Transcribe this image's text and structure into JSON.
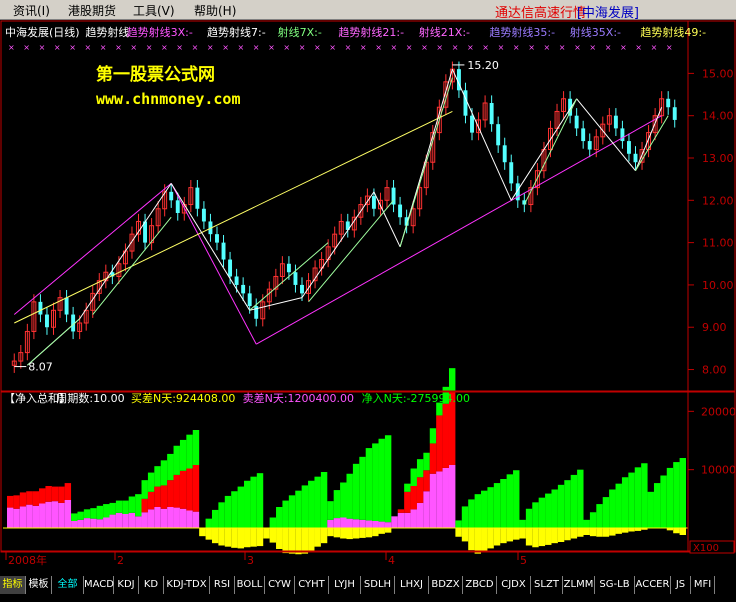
{
  "menu": [
    "资讯(I)",
    "港股期货",
    "工具(V)",
    "帮助(H)"
  ],
  "window": {
    "title": "通达信高速行情",
    "security": "[中海发展]"
  },
  "upper_header": [
    {
      "text": "中海发展(日线)",
      "color": "#ffffff"
    },
    {
      "text": "趋势射线",
      "color": "#ffffff"
    },
    {
      "text": "趋势射线3X:-",
      "color": "#ff55ff"
    },
    {
      "text": "趋势射线7:-",
      "color": "#ffffff"
    },
    {
      "text": "射线7X:-",
      "color": "#80ff80"
    },
    {
      "text": "趋势射线21:-",
      "color": "#ff66ff"
    },
    {
      "text": "射线21X:-",
      "color": "#ff66ff"
    },
    {
      "text": "趋势射线35:-",
      "color": "#9b7bff"
    },
    {
      "text": "射线35X:-",
      "color": "#9b7bff"
    },
    {
      "text": "趋势射线49:-",
      "color": "#ffff55"
    }
  ],
  "watermark": {
    "line1": "第一股票公式网",
    "line2": "www.chnmoney.com"
  },
  "lower_header": [
    {
      "text": "【净入总和】",
      "color": "#ffffff"
    },
    {
      "text": "周期数:10.00",
      "color": "#ffffff"
    },
    {
      "text": "买差N天:924408.00",
      "color": "#ffff00"
    },
    {
      "text": "卖差N天:1200400.00",
      "color": "#ff55ff"
    },
    {
      "text": "净入N天:-275994.00",
      "color": "#00ff00"
    }
  ],
  "price_labels": {
    "high": "15.20",
    "low": "8.07"
  },
  "x100_label": "X100",
  "year_label": "2008年",
  "tabs": [
    "指标",
    "模板",
    "全部",
    "MACD",
    "KDJ",
    "KD",
    "KDJ-TDX",
    "RSI",
    "BOLL",
    "CYW",
    "CYHT",
    "LYJH",
    "SDLH",
    "LHXJ",
    "BDZX",
    "ZBCD",
    "CJDX",
    "SLZT",
    "ZLMM",
    "SG-LB",
    "ACCER",
    "JS",
    "MFI"
  ],
  "chart_data": [
    {
      "type": "candlestick",
      "title": "中海发展(日线)",
      "y_ticks": [
        8.0,
        9.0,
        10.0,
        11.0,
        12.0,
        13.0,
        14.0,
        15.0
      ],
      "ylim": [
        7.8,
        15.6
      ],
      "x_ticks": [
        "2008年",
        "2",
        "3",
        "4",
        "5"
      ],
      "annotations": [
        {
          "text": "15.20",
          "type": "high"
        },
        {
          "text": "8.07",
          "type": "low"
        }
      ],
      "close": [
        8.2,
        8.4,
        8.9,
        9.6,
        9.3,
        9.0,
        9.4,
        9.7,
        9.3,
        8.9,
        9.1,
        9.4,
        9.8,
        10.1,
        10.3,
        10.2,
        10.5,
        10.8,
        11.2,
        11.5,
        11.0,
        11.4,
        11.8,
        12.2,
        12.0,
        11.7,
        11.9,
        12.3,
        11.8,
        11.5,
        11.2,
        11.0,
        10.6,
        10.2,
        10.0,
        9.8,
        9.5,
        9.2,
        9.6,
        9.9,
        10.2,
        10.5,
        10.3,
        10.0,
        9.8,
        10.1,
        10.4,
        10.6,
        10.9,
        11.2,
        11.5,
        11.3,
        11.6,
        11.9,
        12.1,
        11.8,
        12.0,
        12.3,
        11.9,
        11.6,
        11.4,
        11.8,
        12.3,
        12.9,
        13.6,
        14.2,
        14.8,
        15.1,
        14.6,
        14.0,
        13.6,
        13.9,
        14.3,
        13.8,
        13.3,
        12.9,
        12.4,
        12.0,
        11.9,
        12.3,
        12.7,
        13.2,
        13.7,
        14.1,
        14.4,
        14.0,
        13.7,
        13.4,
        13.2,
        13.5,
        13.8,
        14.0,
        13.7,
        13.4,
        13.1,
        12.9,
        13.2,
        13.6,
        14.0,
        14.4,
        14.2,
        13.9
      ],
      "open": [
        8.1,
        8.2,
        8.4,
        8.9,
        9.6,
        9.3,
        9.0,
        9.4,
        9.7,
        9.3,
        8.9,
        9.1,
        9.4,
        9.8,
        10.1,
        10.3,
        10.2,
        10.5,
        10.8,
        11.2,
        11.5,
        11.0,
        11.4,
        11.8,
        12.2,
        12.0,
        11.7,
        11.9,
        12.3,
        11.8,
        11.5,
        11.2,
        11.0,
        10.6,
        10.2,
        10.0,
        9.8,
        9.5,
        9.2,
        9.6,
        9.9,
        10.2,
        10.5,
        10.3,
        10.0,
        9.8,
        10.1,
        10.4,
        10.6,
        10.9,
        11.2,
        11.5,
        11.3,
        11.6,
        11.9,
        12.1,
        11.8,
        12.0,
        12.3,
        11.9,
        11.6,
        11.4,
        11.8,
        12.3,
        12.9,
        13.6,
        14.2,
        14.8,
        15.1,
        14.6,
        14.0,
        13.6,
        13.9,
        14.3,
        13.8,
        13.3,
        12.9,
        12.4,
        12.0,
        11.9,
        12.3,
        12.7,
        13.2,
        13.7,
        14.1,
        14.4,
        14.0,
        13.7,
        13.4,
        13.2,
        13.5,
        13.8,
        14.0,
        13.7,
        13.4,
        13.1,
        12.9,
        13.2,
        13.6,
        14.0,
        14.4,
        14.2
      ],
      "high": 15.2,
      "low": 8.07
    },
    {
      "type": "bar",
      "title": "【净入总和】",
      "y_ticks": [
        10000,
        20000
      ],
      "unit": "X100",
      "series": [
        {
          "name": "买差N天",
          "color": "#ffff00",
          "current": 924408.0
        },
        {
          "name": "卖差N天",
          "color": "#ff55ff",
          "current": 1200400.0
        },
        {
          "name": "净入N天",
          "color": "#00ff00",
          "current": -275994.0
        }
      ],
      "colors": {
        "magenta": "#ff55ff",
        "red": "#ff0000",
        "green": "#00ff00",
        "yellow": "#ffff00"
      },
      "stacks": [
        [
          3500,
          2000,
          0,
          0
        ],
        [
          3300,
          2300,
          0,
          0
        ],
        [
          3700,
          2400,
          0,
          0
        ],
        [
          4000,
          2300,
          0,
          0
        ],
        [
          3800,
          2500,
          0,
          0
        ],
        [
          4200,
          2600,
          0,
          0
        ],
        [
          4500,
          2700,
          0,
          0
        ],
        [
          4600,
          2500,
          0,
          0
        ],
        [
          4300,
          2800,
          0,
          0
        ],
        [
          4800,
          2900,
          0,
          0
        ],
        [
          1200,
          0,
          1300,
          0
        ],
        [
          1400,
          0,
          1400,
          0
        ],
        [
          1700,
          0,
          1500,
          0
        ],
        [
          1600,
          0,
          1800,
          0
        ],
        [
          1500,
          0,
          2300,
          0
        ],
        [
          1800,
          0,
          2300,
          0
        ],
        [
          2300,
          0,
          2000,
          0
        ],
        [
          2600,
          0,
          2100,
          0
        ],
        [
          2400,
          0,
          2300,
          0
        ],
        [
          2600,
          0,
          2800,
          0
        ],
        [
          2000,
          0,
          3800,
          0
        ],
        [
          2700,
          2300,
          3200,
          0
        ],
        [
          3200,
          3000,
          3300,
          0
        ],
        [
          3600,
          3500,
          3500,
          0
        ],
        [
          3300,
          4000,
          4300,
          0
        ],
        [
          3600,
          4600,
          4500,
          0
        ],
        [
          3500,
          5600,
          5000,
          0
        ],
        [
          3300,
          6500,
          5300,
          0
        ],
        [
          3000,
          7200,
          5800,
          0
        ],
        [
          2800,
          8000,
          6000,
          0
        ],
        [
          0,
          0,
          0,
          -1400
        ],
        [
          0,
          0,
          1600,
          -2000
        ],
        [
          0,
          0,
          3100,
          -2600
        ],
        [
          0,
          0,
          4400,
          -3000
        ],
        [
          0,
          0,
          5500,
          -3200
        ],
        [
          0,
          0,
          6300,
          -3400
        ],
        [
          0,
          0,
          7100,
          -3500
        ],
        [
          0,
          0,
          8100,
          -3300
        ],
        [
          0,
          0,
          8800,
          -3200
        ],
        [
          0,
          0,
          9400,
          -3100
        ],
        [
          0,
          0,
          0,
          -1800
        ],
        [
          0,
          0,
          1800,
          -2500
        ],
        [
          0,
          0,
          3600,
          -3600
        ],
        [
          0,
          0,
          4700,
          -4300
        ],
        [
          0,
          0,
          5600,
          -4400
        ],
        [
          0,
          0,
          6400,
          -4500
        ],
        [
          0,
          0,
          7300,
          -4400
        ],
        [
          0,
          0,
          8100,
          -3900
        ],
        [
          0,
          0,
          8800,
          -3200
        ],
        [
          0,
          0,
          9600,
          -2600
        ],
        [
          1400,
          0,
          3200,
          -1400
        ],
        [
          1700,
          0,
          4800,
          -1600
        ],
        [
          1800,
          0,
          6000,
          -1800
        ],
        [
          1600,
          0,
          7700,
          -1900
        ],
        [
          1500,
          0,
          9500,
          -1800
        ],
        [
          1400,
          0,
          10800,
          -1700
        ],
        [
          1300,
          0,
          12400,
          -1600
        ],
        [
          1200,
          0,
          13300,
          -1400
        ],
        [
          1100,
          0,
          14200,
          -1000
        ],
        [
          1000,
          0,
          14900,
          -800
        ],
        [
          2000,
          0,
          0,
          0
        ],
        [
          2600,
          600,
          0,
          0
        ],
        [
          2600,
          3600,
          1400,
          0
        ],
        [
          3200,
          4000,
          3000,
          0
        ],
        [
          4300,
          4400,
          3100,
          0
        ],
        [
          6300,
          3600,
          3000,
          0
        ],
        [
          9300,
          5200,
          2600,
          0
        ],
        [
          9700,
          9600,
          2200,
          0
        ],
        [
          10300,
          11000,
          2900,
          0
        ],
        [
          10800,
          12600,
          4000,
          0
        ],
        [
          0,
          0,
          1300,
          -1500
        ],
        [
          0,
          0,
          3700,
          -2300
        ],
        [
          0,
          0,
          4900,
          -3800
        ],
        [
          0,
          0,
          5800,
          -4400
        ],
        [
          0,
          0,
          6400,
          -4000
        ],
        [
          0,
          0,
          7000,
          -3500
        ],
        [
          0,
          0,
          7700,
          -3000
        ],
        [
          0,
          0,
          8400,
          -2600
        ],
        [
          0,
          0,
          9200,
          -2300
        ],
        [
          0,
          0,
          9900,
          -2000
        ],
        [
          0,
          0,
          1400,
          -1800
        ],
        [
          0,
          0,
          3300,
          -3000
        ],
        [
          0,
          0,
          4400,
          -3300
        ],
        [
          0,
          0,
          5200,
          -3100
        ],
        [
          0,
          0,
          5900,
          -2900
        ],
        [
          0,
          0,
          6600,
          -2600
        ],
        [
          0,
          0,
          7400,
          -2400
        ],
        [
          0,
          0,
          8200,
          -2100
        ],
        [
          0,
          0,
          9100,
          -1800
        ],
        [
          0,
          0,
          10000,
          -1500
        ],
        [
          0,
          0,
          1400,
          -1200
        ],
        [
          0,
          0,
          2700,
          -1400
        ],
        [
          0,
          0,
          4100,
          -1500
        ],
        [
          0,
          0,
          5300,
          -1500
        ],
        [
          0,
          0,
          6600,
          -1300
        ],
        [
          0,
          0,
          7600,
          -1000
        ],
        [
          0,
          0,
          8700,
          -800
        ],
        [
          0,
          0,
          9500,
          -600
        ],
        [
          0,
          0,
          10400,
          -500
        ],
        [
          0,
          0,
          11100,
          -300
        ],
        [
          0,
          0,
          6200,
          0
        ],
        [
          0,
          0,
          7700,
          0
        ],
        [
          0,
          0,
          9000,
          0
        ],
        [
          0,
          0,
          10300,
          -400
        ],
        [
          0,
          0,
          11300,
          -900
        ],
        [
          0,
          0,
          12000,
          -1200
        ]
      ]
    }
  ]
}
